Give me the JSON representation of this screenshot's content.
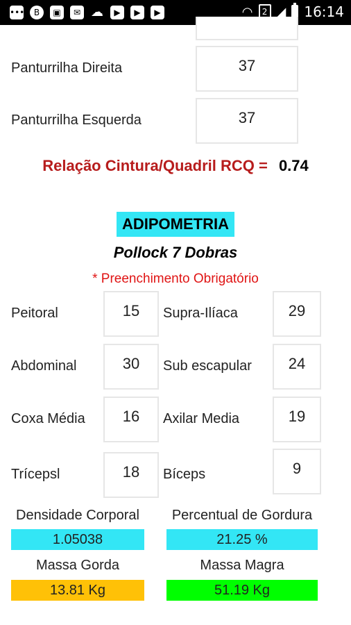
{
  "status_bar": {
    "time": "16:14",
    "sim_label": "2",
    "icons": [
      "chat-icon",
      "b-icon",
      "image-icon",
      "mail-icon",
      "cloud-icon",
      "youtube-icon",
      "youtube-icon",
      "youtube-icon",
      "wifi-icon",
      "sim-icon",
      "signal-icon",
      "battery-icon"
    ]
  },
  "measures": {
    "panturrilha_direita": {
      "label": "Panturrilha Direita",
      "value": "37"
    },
    "panturrilha_esquerda": {
      "label": "Panturrilha Esquerda",
      "value": "37"
    }
  },
  "rcq": {
    "label": "Relação Cintura/Quadril RCQ =",
    "value": "0.74"
  },
  "adipometria": {
    "title": "ADIPOMETRIA",
    "subtitle": "Pollock 7 Dobras",
    "required_note": "*  Preenchimento Obrigatório",
    "folds": {
      "peitoral": {
        "label": "Peitoral",
        "value": "15"
      },
      "supra_iliaca": {
        "label": "Supra-Ilíaca",
        "value": "29"
      },
      "abdominal": {
        "label": "Abdominal",
        "value": "30"
      },
      "sub_escapular": {
        "label": "Sub escapular",
        "value": "24"
      },
      "coxa_media": {
        "label": "Coxa Média",
        "value": "16"
      },
      "axilar_media": {
        "label": "Axilar Media",
        "value": "19"
      },
      "triceps": {
        "label": "Trícepsl",
        "value": "18"
      },
      "biceps": {
        "label": "Bíceps",
        "value": "9"
      }
    }
  },
  "results": {
    "densidade": {
      "label": "Densidade Corporal",
      "value": "1.05038"
    },
    "percentual": {
      "label": "Percentual de Gordura",
      "value": "21.25 %"
    },
    "massa_gorda": {
      "label": "Massa Gorda",
      "value": "13.81 Kg"
    },
    "massa_magra": {
      "label": "Massa Magra",
      "value": "51.19 Kg"
    }
  },
  "colors": {
    "cyan": "#33e6f5",
    "orange": "#ffc107",
    "green": "#00ff00",
    "red_label": "#b71c1c",
    "required_red": "#e01414"
  }
}
